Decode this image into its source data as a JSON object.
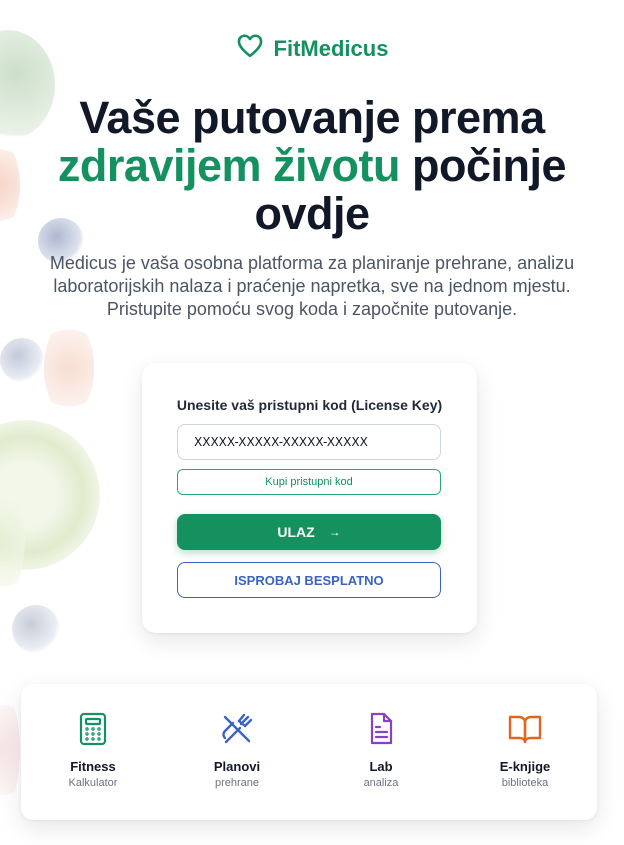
{
  "brand": {
    "name": "FitMedicus",
    "icon": "heart-icon",
    "color": "#15905f"
  },
  "hero": {
    "title_part1": "Vaše putovanje prema",
    "title_accent": "zdravijem životu",
    "title_part2": "počinje ovdje",
    "subtitle": "Medicus je vaša osobna platforma za planiranje prehrane, analizu laboratorijskih nalaza i praćenje napretka, sve na jednom mjestu. Pristupite pomoću svog koda i započnite putovanje."
  },
  "login": {
    "label": "Unesite vaš pristupni kod (License Key)",
    "key_value": "XXXXX-XXXXX-XXXXX-XXXXX",
    "key_placeholder": "XXXXX-XXXXX-XXXXX-XXXXX",
    "buy_label": "Kupi pristupni kod",
    "enter_label": "ULAZ",
    "enter_arrow": "→",
    "try_label": "ISPROBAJ BESPLATNO"
  },
  "features": [
    {
      "title": "Fitness",
      "subtitle": "Kalkulator",
      "icon": "calculator-icon",
      "color": "#15905f"
    },
    {
      "title": "Planovi",
      "subtitle": "prehrane",
      "icon": "fork-knife-icon",
      "color": "#3b63c4"
    },
    {
      "title": "Lab",
      "subtitle": "analiza",
      "icon": "document-icon",
      "color": "#8b3fc7"
    },
    {
      "title": "E-knjige",
      "subtitle": "biblioteka",
      "icon": "book-icon",
      "color": "#e0661f"
    }
  ],
  "colors": {
    "accent": "#15905f",
    "secondary": "#3b63c4",
    "text": "#111827",
    "muted": "#4b5563"
  }
}
